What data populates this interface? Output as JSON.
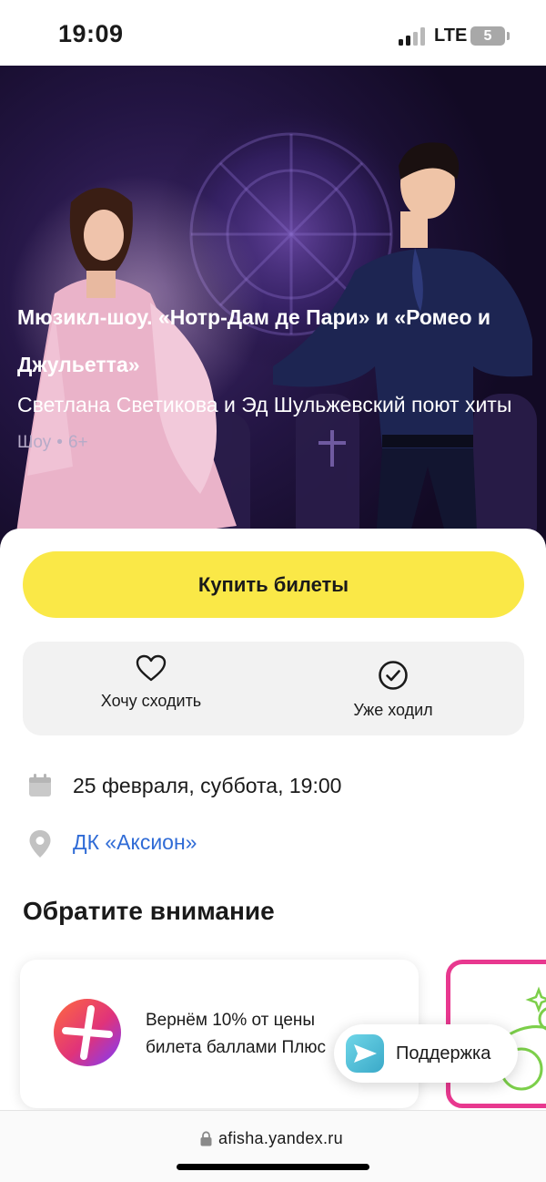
{
  "status_bar": {
    "time": "19:09",
    "network": "LTE",
    "battery": "5"
  },
  "event": {
    "title": "Мюзикл-шоу. «Нотр-Дам де Пари» и «Ромео и Джульетта»",
    "subtitle": "Светлана Светикова и Эд Шульжевский поют хиты",
    "category": "Шоу",
    "age_rating": "6+"
  },
  "actions": {
    "buy_label": "Купить билеты",
    "want_label": "Хочу сходить",
    "visited_label": "Уже ходил"
  },
  "details": {
    "date": "25 февраля, суббота, 19:00",
    "venue": "ДК «Аксион»"
  },
  "notice": {
    "title": "Обратите внимание",
    "promo_text": "Вернём 10% от цены билета баллами Плюс"
  },
  "support": {
    "label": "Поддержка"
  },
  "browser": {
    "url": "afisha.yandex.ru"
  },
  "colors": {
    "accent": "#fae847",
    "link": "#2f6bd6",
    "promo_border": "#e8388f"
  }
}
